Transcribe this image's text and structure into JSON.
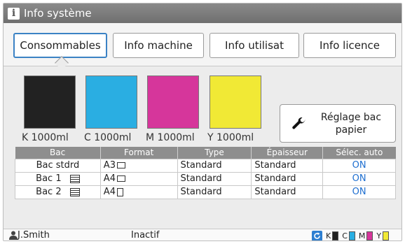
{
  "window": {
    "title": "Info système"
  },
  "tabs": [
    {
      "label": "Consommables",
      "active": true
    },
    {
      "label": "Info machine",
      "active": false
    },
    {
      "label": "Info utilisat",
      "active": false
    },
    {
      "label": "Info licence",
      "active": false
    }
  ],
  "inks": [
    {
      "letter": "K",
      "label": "K  1000ml",
      "color": "#222222"
    },
    {
      "letter": "C",
      "label": "C  1000ml",
      "color": "#2aaee2"
    },
    {
      "letter": "M",
      "label": "M  1000ml",
      "color": "#d6369b"
    },
    {
      "letter": "Y",
      "label": "Y  1000ml",
      "color": "#f1e935"
    }
  ],
  "tray_button": {
    "label_line1": "Réglage bac",
    "label_line2": "papier"
  },
  "table": {
    "headers": [
      "Bac",
      "Format",
      "Type",
      "Épaisseur",
      "Sélec. auto"
    ],
    "rows": [
      {
        "bac": "Bac stdrd",
        "format": "A3",
        "orientation": "landscape",
        "type": "Standard",
        "thickness": "Standard",
        "auto": "ON",
        "has_list_icon": false
      },
      {
        "bac": "Bac 1",
        "format": "A4",
        "orientation": "landscape",
        "type": "Standard",
        "thickness": "Standard",
        "auto": "ON",
        "has_list_icon": true
      },
      {
        "bac": "Bac 2",
        "format": "A4",
        "orientation": "portrait",
        "type": "Standard",
        "thickness": "Standard",
        "auto": "ON",
        "has_list_icon": true
      }
    ]
  },
  "statusbar": {
    "user": "J.Smith",
    "status": "Inactif",
    "ink_levels": [
      {
        "letter": "K",
        "color": "#222222",
        "fill": 1.0
      },
      {
        "letter": "C",
        "color": "#2aaee2",
        "fill": 1.0
      },
      {
        "letter": "M",
        "color": "#d6369b",
        "fill": 1.0
      },
      {
        "letter": "Y",
        "color": "#f1e935",
        "fill": 1.0
      }
    ]
  },
  "colors": {
    "accent": "#3b82c4",
    "on_text": "#1f6fd0"
  }
}
